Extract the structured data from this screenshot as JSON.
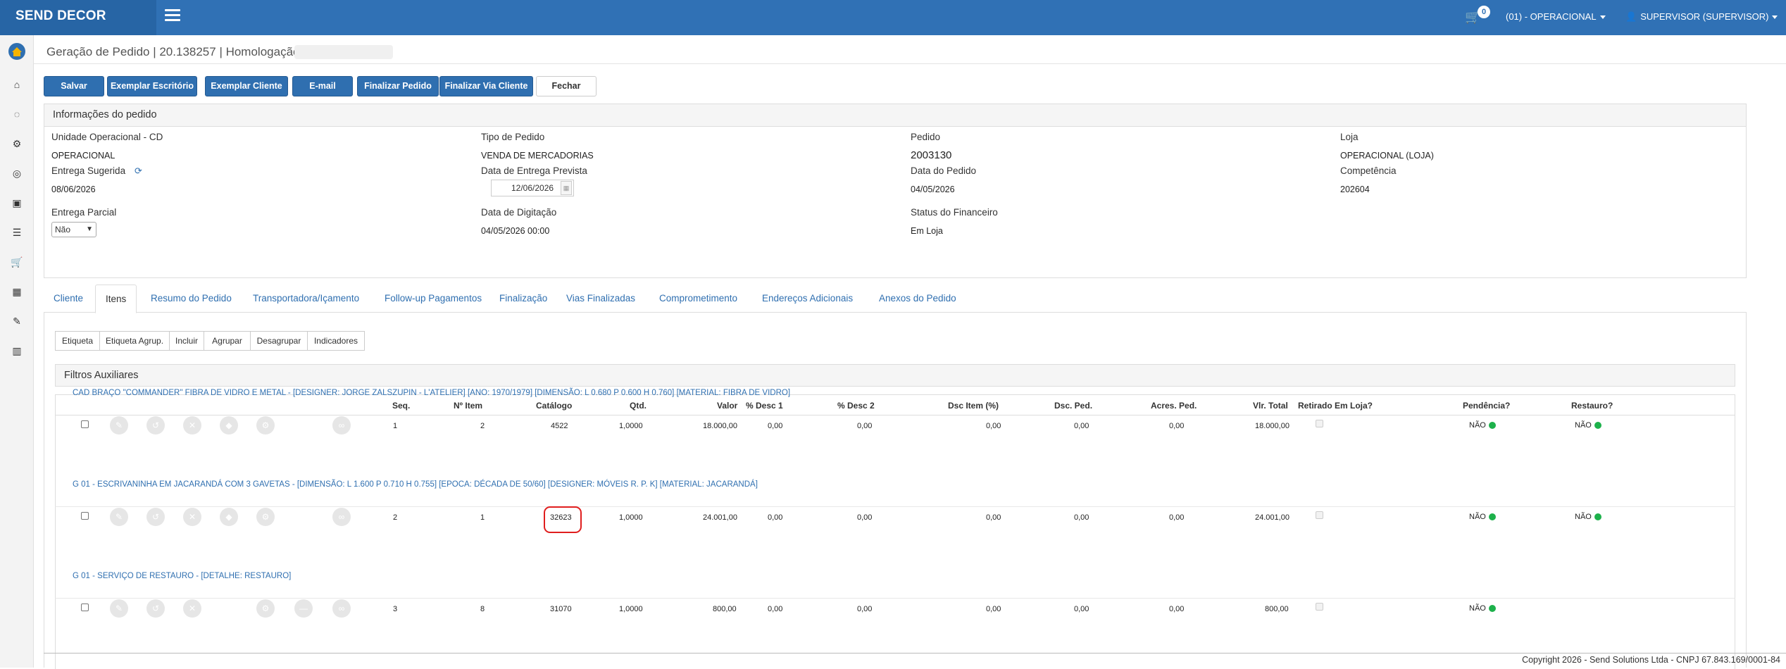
{
  "header": {
    "brand": "SEND DECOR",
    "cart_count": "0",
    "unit": "(01) - OPERACIONAL",
    "user": "SUPERVISOR (SUPERVISOR)"
  },
  "sidebar": {
    "icons": [
      "logo-icon",
      "home-icon",
      "spinner-icon",
      "cogs-icon",
      "target-icon",
      "money-icon",
      "sliders-icon",
      "cart-icon",
      "image-icon",
      "wrench-icon",
      "chart-icon"
    ]
  },
  "page": {
    "title": "Geração de Pedido | 20.138257 | Homologação |"
  },
  "toolbar": {
    "salvar": "Salvar",
    "exemplar_escritorio": "Exemplar Escritório",
    "exemplar_cliente": "Exemplar Cliente",
    "email": "E-mail",
    "finalizar_pedido": "Finalizar Pedido",
    "finalizar_via_cliente": "Finalizar Via Cliente",
    "fechar": "Fechar"
  },
  "info": {
    "header": "Informações do pedido",
    "unidade_label": "Unidade Operacional - CD",
    "unidade_value": "OPERACIONAL",
    "tipo_label": "Tipo de Pedido",
    "tipo_value": "VENDA DE MERCADORIAS",
    "pedido_label": "Pedido",
    "pedido_value": "2003130",
    "loja_label": "Loja",
    "loja_value": "OPERACIONAL (LOJA)",
    "entrega_sugerida_label": "Entrega Sugerida",
    "entrega_sugerida_value": "08/06/2026",
    "entrega_prevista_label": "Data de Entrega Prevista",
    "entrega_prevista_value": "12/06/2026",
    "data_pedido_label": "Data do Pedido",
    "data_pedido_value": "04/05/2026",
    "competencia_label": "Competência",
    "competencia_value": "202604",
    "entrega_parcial_label": "Entrega Parcial",
    "entrega_parcial_value": "Não",
    "digitacao_label": "Data de Digitação",
    "digitacao_value": "04/05/2026 00:00",
    "financeiro_label": "Status do Financeiro",
    "financeiro_value": "Em Loja"
  },
  "tabs": [
    "Cliente",
    "Itens",
    "Resumo do Pedido",
    "Transportadora/Içamento",
    "Follow-up Pagamentos",
    "Finalização",
    "Vias Finalizadas",
    "Comprometimento",
    "Endereços Adicionais",
    "Anexos do Pedido"
  ],
  "items_toolbar": [
    "Etiqueta",
    "Etiqueta Agrup.",
    "Incluir",
    "Agrupar",
    "Desagrupar",
    "Indicadores"
  ],
  "filters": {
    "title": "Filtros Auxiliares"
  },
  "table": {
    "headers": [
      "Seq.",
      "Nº Item",
      "Catálogo",
      "Qtd.",
      "Valor",
      "% Desc 1",
      "% Desc 2",
      "Dsc Item (%)",
      "Dsc. Ped.",
      "Acres. Ped.",
      "Vlr. Total",
      "Retirado Em Loja?",
      "Pendência?",
      "Restauro?"
    ],
    "rows": [
      {
        "desc": "CAD BRAÇO \"COMMANDER\" FIBRA DE VIDRO E METAL - [DESIGNER: JORGE ZALSZUPIN - L'ATELIER] [ANO: 1970/1979] [DIMENSÃO: L 0.680 P 0.600 H 0.760] [MATERIAL: FIBRA DE VIDRO]",
        "seq": "1",
        "item": "2",
        "catalogo": "4522",
        "qtd": "1,0000",
        "valor": "18.000,00",
        "desc1": "0,00",
        "desc2": "0,00",
        "dsc_item": "0,00",
        "dsc_ped": "0,00",
        "acres_ped": "0,00",
        "total": "18.000,00",
        "pendencia": "NÃO",
        "restauro": "NÃO"
      },
      {
        "desc": "G 01 - ESCRIVANINHA EM JACARANDÁ COM 3 GAVETAS - [DIMENSÃO: L 1.600 P 0.710 H 0.755] [EPOCA: DÉCADA DE 50/60] [DESIGNER: MÓVEIS R. P. K] [MATERIAL: JACARANDÁ]",
        "seq": "2",
        "item": "1",
        "catalogo": "32623",
        "qtd": "1,0000",
        "valor": "24.001,00",
        "desc1": "0,00",
        "desc2": "0,00",
        "dsc_item": "0,00",
        "dsc_ped": "0,00",
        "acres_ped": "0,00",
        "total": "24.001,00",
        "pendencia": "NÃO",
        "restauro": "NÃO"
      },
      {
        "desc": "G 01 - SERVIÇO DE RESTAURO - [DETALHE: RESTAURO]",
        "seq": "3",
        "item": "8",
        "catalogo": "31070",
        "qtd": "1,0000",
        "valor": "800,00",
        "desc1": "0,00",
        "desc2": "0,00",
        "dsc_item": "0,00",
        "dsc_ped": "0,00",
        "acres_ped": "0,00",
        "total": "800,00",
        "pendencia": "NÃO",
        "restauro": ""
      }
    ]
  },
  "footer": "Copyright 2026 - Send Solutions Ltda - CNPJ 67.843.169/0001-84",
  "colors": {
    "brand_blue": "#3071b5",
    "link_blue": "#2f6fb0",
    "status_green": "#1db14b",
    "highlight_red": "#e01e1e"
  }
}
